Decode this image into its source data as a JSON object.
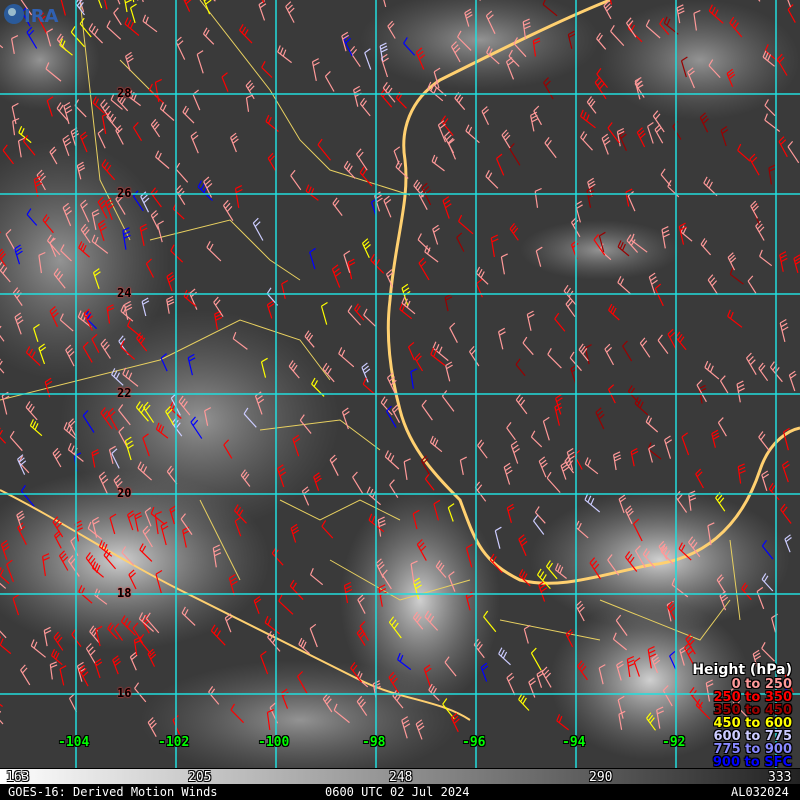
{
  "title": "GOES-16: Derived Motion Winds",
  "datetime": "0600 UTC 02 Jul 2024",
  "storm_id": "AL032024",
  "logo": "CIRA",
  "latitude_labels": [
    "28",
    "26",
    "24",
    "22",
    "20",
    "18",
    "16"
  ],
  "longitude_labels": [
    "-104",
    "-102",
    "-100",
    "-98",
    "-96",
    "-94",
    "-92"
  ],
  "colorbar_labels": [
    "163",
    "205",
    "248",
    "290",
    "333"
  ],
  "legend": {
    "title": "Height (hPa)",
    "items": [
      {
        "label": "0 to 250",
        "color": "#ff9999"
      },
      {
        "label": "250 to 350",
        "color": "#ff0000"
      },
      {
        "label": "350 to 450",
        "color": "#990000"
      },
      {
        "label": "450 to 600",
        "color": "#ffff00"
      },
      {
        "label": "600 to 775",
        "color": "#ccccff"
      },
      {
        "label": "775 to 900",
        "color": "#8888ff"
      },
      {
        "label": "900 to SFC",
        "color": "#0000ff"
      }
    ]
  },
  "colors": {
    "grid": "#22dddd",
    "coast": "#ffd070",
    "border": "#e8d060"
  }
}
